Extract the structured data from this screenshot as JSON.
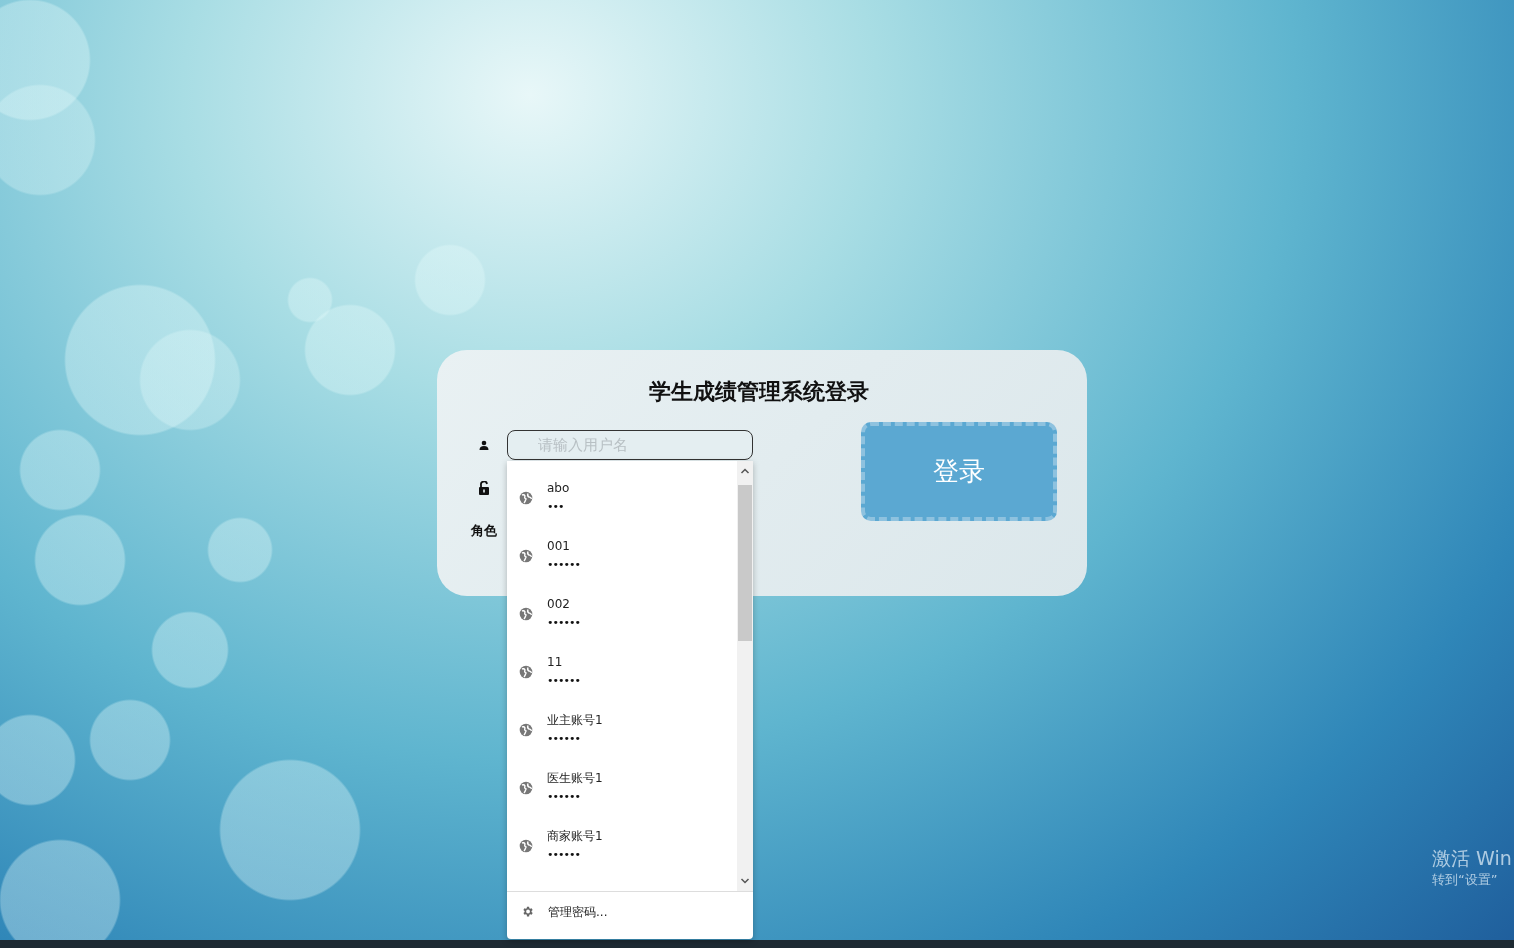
{
  "login": {
    "title": "学生成绩管理系统登录",
    "username_field": {
      "placeholder": "请输入用户名"
    },
    "role_label": "角色",
    "login_button": "登录"
  },
  "autofill_popup": {
    "items": [
      {
        "username": "abo",
        "password": "•••"
      },
      {
        "username": "001",
        "password": "••••••"
      },
      {
        "username": "002",
        "password": "••••••"
      },
      {
        "username": "11",
        "password": "••••••"
      },
      {
        "username": "业主账号1",
        "password": "••••••"
      },
      {
        "username": "医生账号1",
        "password": "••••••"
      },
      {
        "username": "商家账号1",
        "password": "••••••"
      }
    ],
    "manage_link": "管理密码..."
  },
  "os_notice": {
    "line_1": "激活 Win",
    "line_2": "转到“设置”"
  }
}
